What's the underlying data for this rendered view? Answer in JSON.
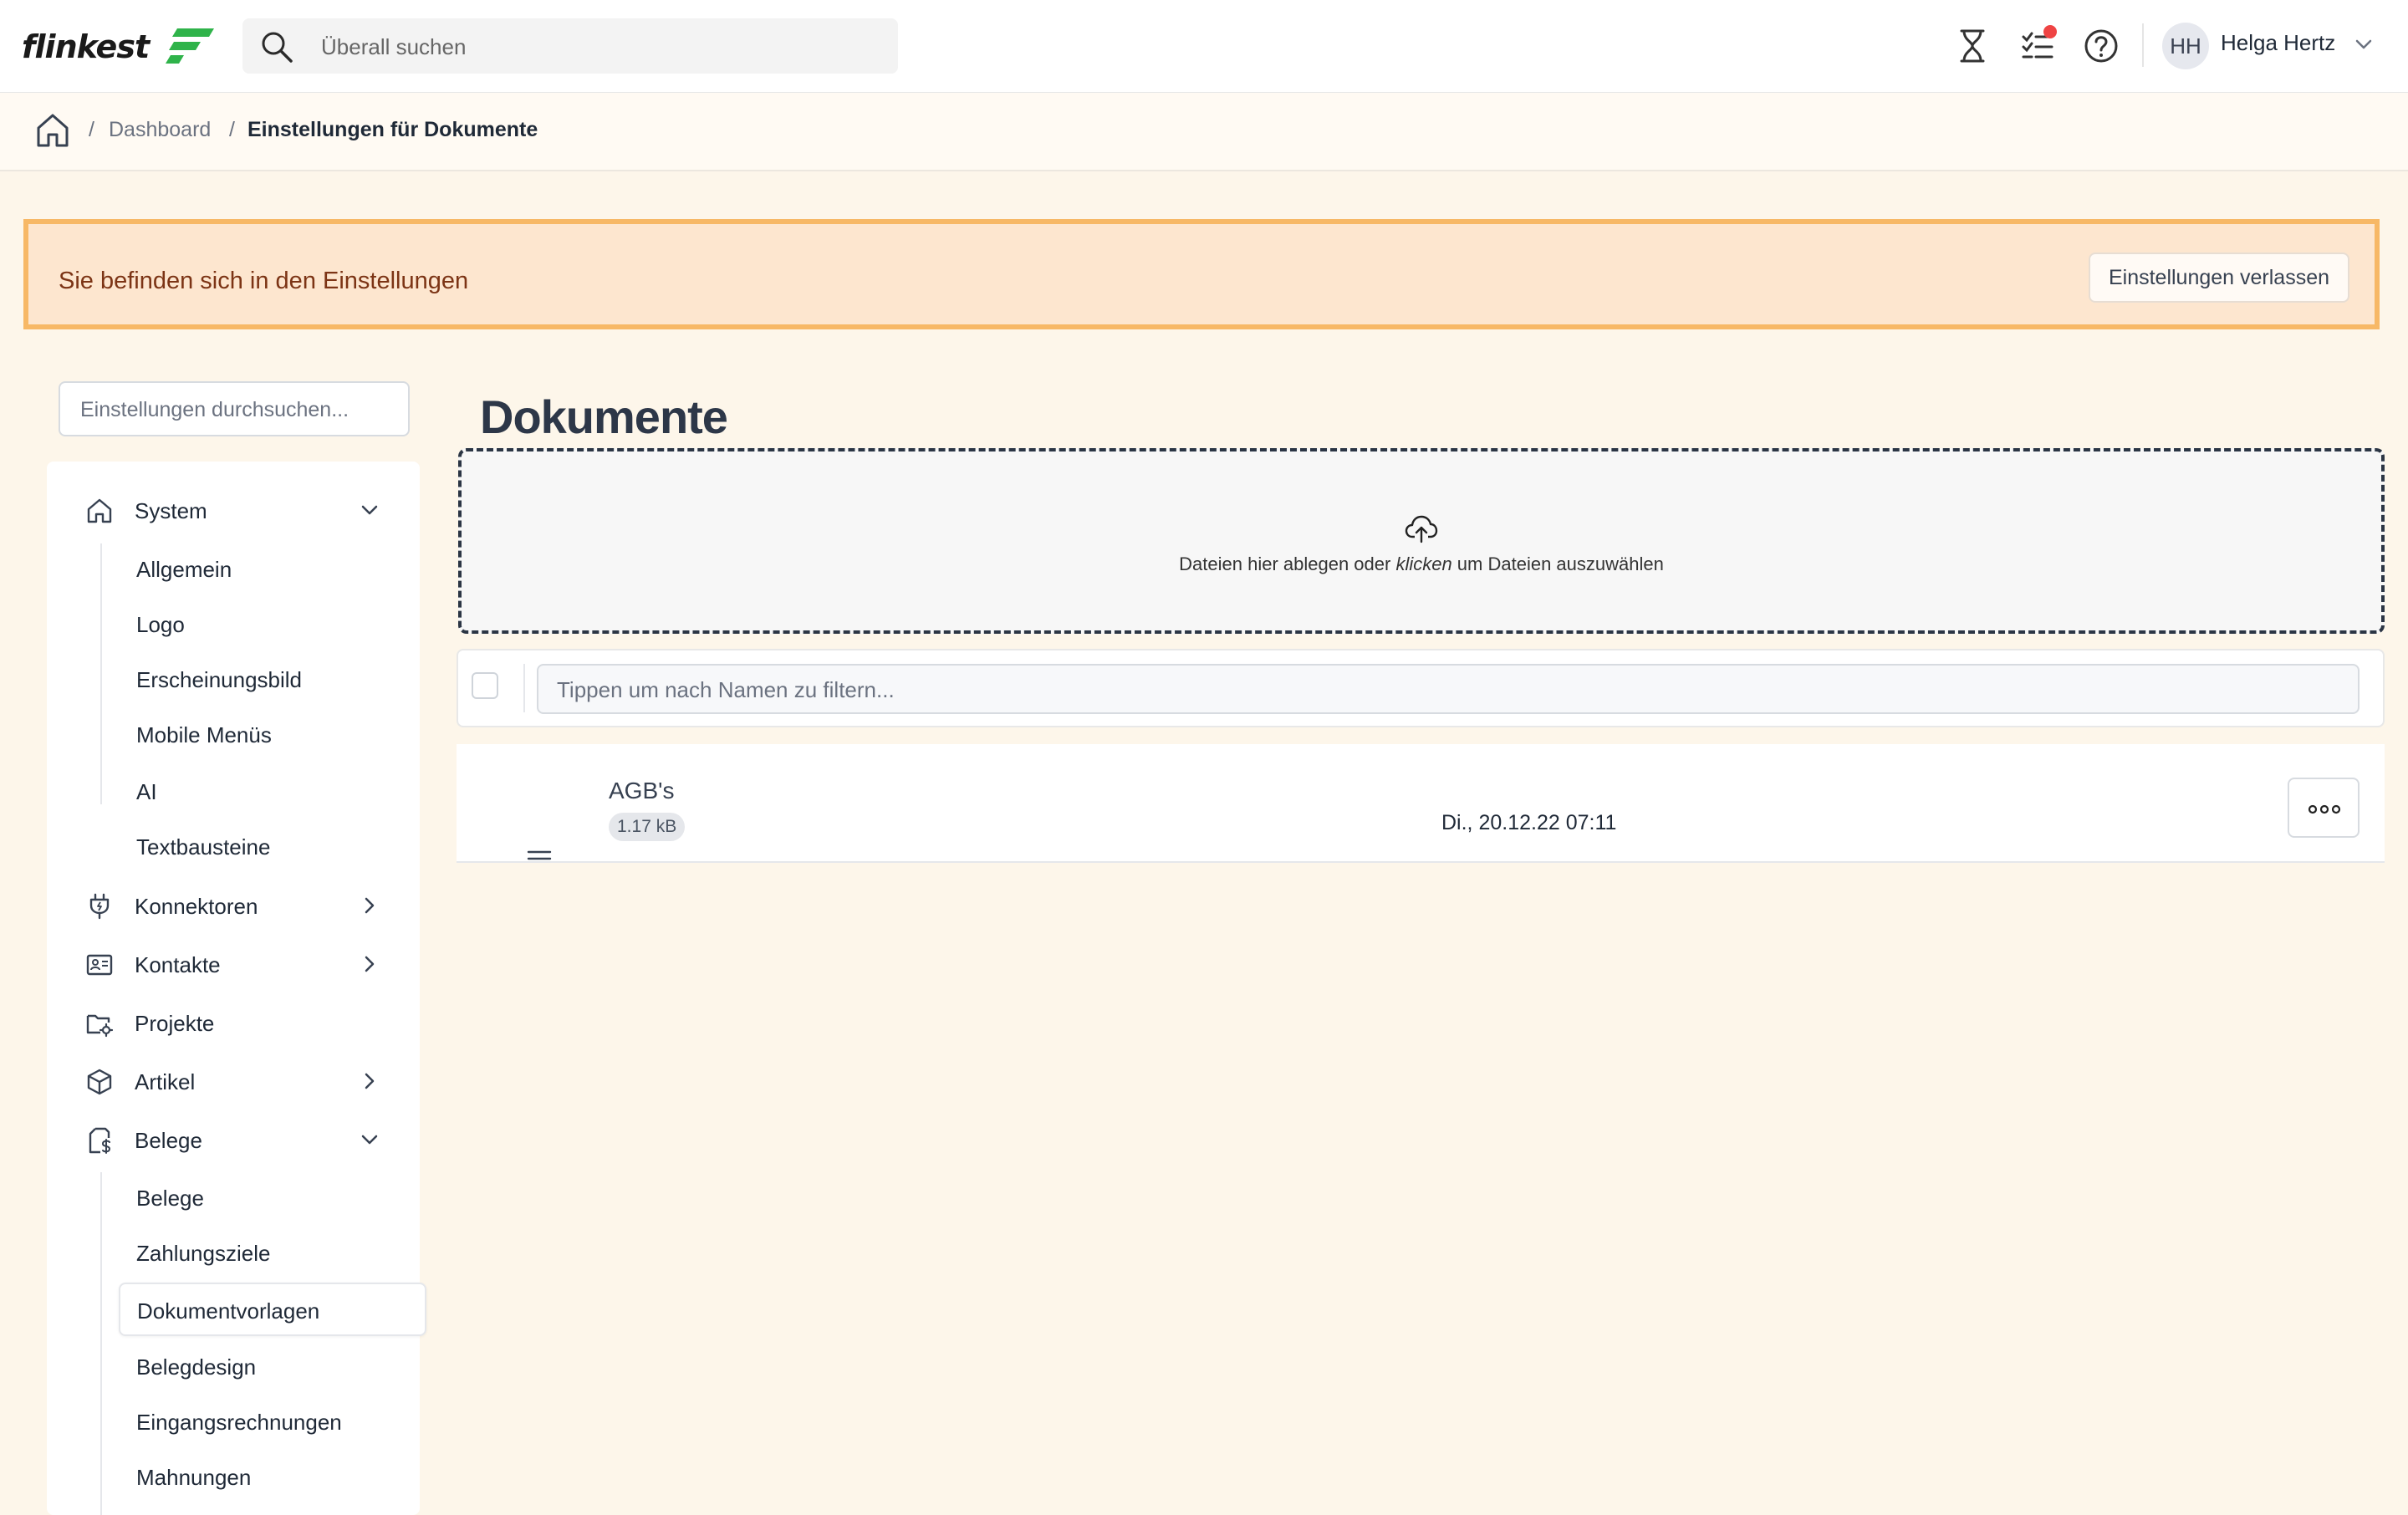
{
  "app": {
    "logo_text": "flinkest",
    "brand_color": "#2fb34a"
  },
  "header": {
    "search_placeholder": "Überall suchen",
    "icons": [
      "hourglass-icon",
      "tasks-icon",
      "help-icon"
    ],
    "user": {
      "initials": "HH",
      "name": "Helga Hertz"
    }
  },
  "breadcrumb": {
    "items": [
      "Dashboard",
      "Einstellungen für Dokumente"
    ]
  },
  "notice": {
    "text": "Sie befinden sich in den Einstellungen",
    "button_label": "Einstellungen verlassen",
    "border_color": "#f7b866",
    "background_color": "#fde6cf"
  },
  "sidebar": {
    "search_placeholder": "Einstellungen durchsuchen...",
    "sections": [
      {
        "label": "System",
        "icon": "home-icon",
        "expanded": true,
        "children": [
          "Allgemein",
          "Logo",
          "Erscheinungsbild",
          "Mobile Menüs",
          "AI",
          "Textbausteine"
        ]
      },
      {
        "label": "Konnektoren",
        "icon": "plug-icon",
        "expanded": false
      },
      {
        "label": "Kontakte",
        "icon": "contact-card-icon",
        "expanded": false
      },
      {
        "label": "Projekte",
        "icon": "folder-gear-icon",
        "expanded": false
      },
      {
        "label": "Artikel",
        "icon": "box-icon",
        "expanded": false
      },
      {
        "label": "Belege",
        "icon": "receipt-icon",
        "expanded": true,
        "children": [
          "Belege",
          "Zahlungsziele",
          "Dokumentvorlagen",
          "Belegdesign",
          "Eingangsrechnungen",
          "Mahnungen"
        ]
      }
    ],
    "active_item": "Dokumentvorlagen"
  },
  "main": {
    "title": "Dokumente",
    "dropzone": {
      "text_before": "Dateien hier ablegen oder ",
      "text_emphasis": "klicken",
      "text_after": " um Dateien auszuwählen"
    },
    "filter_placeholder": "Tippen um nach Namen zu filtern...",
    "documents": [
      {
        "name": "AGB's",
        "size": "1.17 kB",
        "date": "Di., 20.12.22 07:11"
      }
    ]
  }
}
